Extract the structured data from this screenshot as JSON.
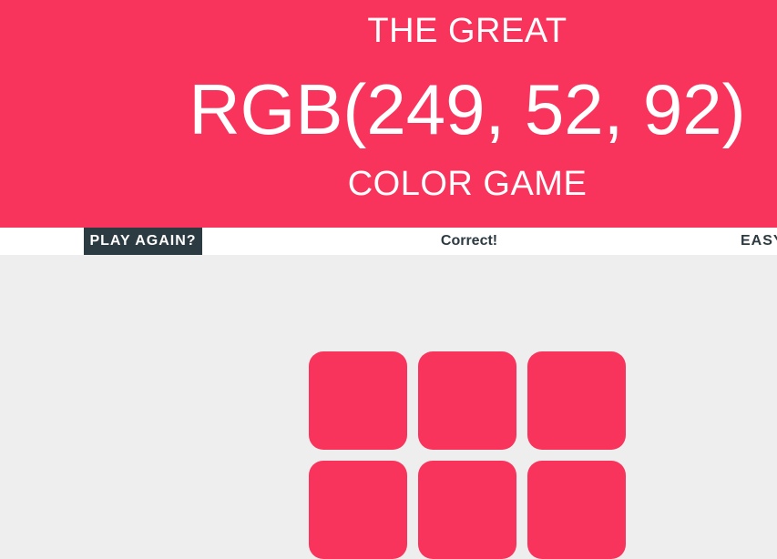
{
  "header": {
    "line1": "THE GREAT",
    "rgb_display": "RGB(249, 52, 92)",
    "line3": "COLOR GAME",
    "background": "#f9345c"
  },
  "stripe": {
    "play_again_label": "PLAY AGAIN?",
    "message": "Correct!",
    "mode_label": "EASY"
  },
  "squares": [
    {
      "color": "#f9345c"
    },
    {
      "color": "#f9345c"
    },
    {
      "color": "#f9345c"
    },
    {
      "color": "#f9345c"
    },
    {
      "color": "#f9345c"
    },
    {
      "color": "#f9345c"
    }
  ]
}
